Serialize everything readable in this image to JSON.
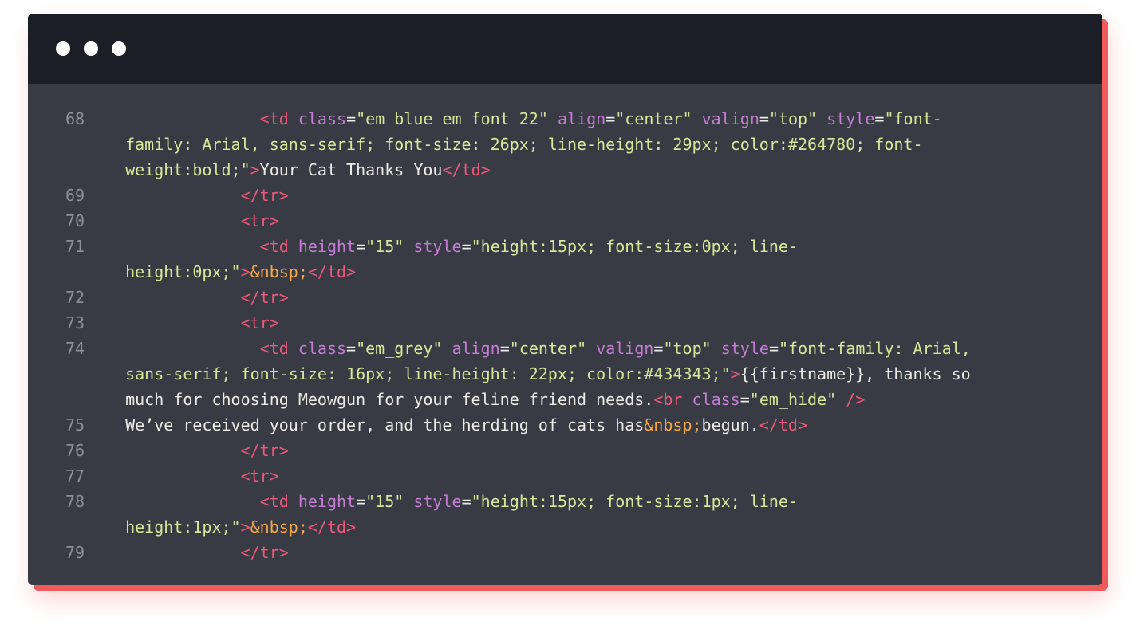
{
  "window": {
    "controls": [
      "window-dot-1",
      "window-dot-2",
      "window-dot-3"
    ]
  },
  "code": {
    "lines": [
      {
        "num": "68",
        "rows": [
          [
            {
              "t": "                <",
              "c": "tag"
            },
            {
              "t": "td",
              "c": "tag"
            },
            {
              "t": " ",
              "c": "plain"
            },
            {
              "t": "class",
              "c": "attr"
            },
            {
              "t": "=",
              "c": "plain"
            },
            {
              "t": "\"em_blue em_font_22\"",
              "c": "str"
            },
            {
              "t": " ",
              "c": "plain"
            },
            {
              "t": "align",
              "c": "attr"
            },
            {
              "t": "=",
              "c": "plain"
            },
            {
              "t": "\"center\"",
              "c": "str"
            },
            {
              "t": " ",
              "c": "plain"
            },
            {
              "t": "valign",
              "c": "attr"
            },
            {
              "t": "=",
              "c": "plain"
            },
            {
              "t": "\"top\"",
              "c": "str"
            },
            {
              "t": " ",
              "c": "plain"
            },
            {
              "t": "style",
              "c": "attr"
            },
            {
              "t": "=",
              "c": "plain"
            },
            {
              "t": "\"font-",
              "c": "str"
            }
          ],
          [
            {
              "t": "  family: Arial, sans-serif; font-size: 26px; line-height: 29px; color:#264780; font-",
              "c": "str"
            }
          ],
          [
            {
              "t": "  weight:bold;\"",
              "c": "str"
            },
            {
              "t": ">",
              "c": "tag"
            },
            {
              "t": "Your Cat Thanks You",
              "c": "plain"
            },
            {
              "t": "</td>",
              "c": "tag"
            }
          ]
        ]
      },
      {
        "num": "69",
        "rows": [
          [
            {
              "t": "              </tr>",
              "c": "tag"
            }
          ]
        ]
      },
      {
        "num": "70",
        "rows": [
          [
            {
              "t": "              <tr>",
              "c": "tag"
            }
          ]
        ]
      },
      {
        "num": "71",
        "rows": [
          [
            {
              "t": "                <td ",
              "c": "tag"
            },
            {
              "t": "height",
              "c": "attr"
            },
            {
              "t": "=",
              "c": "plain"
            },
            {
              "t": "\"15\"",
              "c": "str"
            },
            {
              "t": " ",
              "c": "plain"
            },
            {
              "t": "style",
              "c": "attr"
            },
            {
              "t": "=",
              "c": "plain"
            },
            {
              "t": "\"height:15px; font-size:0px; line-",
              "c": "str"
            }
          ],
          [
            {
              "t": "  height:0px;\"",
              "c": "str"
            },
            {
              "t": ">",
              "c": "tag"
            },
            {
              "t": "&nbsp;",
              "c": "ent"
            },
            {
              "t": "</td>",
              "c": "tag"
            }
          ]
        ]
      },
      {
        "num": "72",
        "rows": [
          [
            {
              "t": "              </tr>",
              "c": "tag"
            }
          ]
        ]
      },
      {
        "num": "73",
        "rows": [
          [
            {
              "t": "              <tr>",
              "c": "tag"
            }
          ]
        ]
      },
      {
        "num": "74",
        "rows": [
          [
            {
              "t": "                <td ",
              "c": "tag"
            },
            {
              "t": "class",
              "c": "attr"
            },
            {
              "t": "=",
              "c": "plain"
            },
            {
              "t": "\"em_grey\"",
              "c": "str"
            },
            {
              "t": " ",
              "c": "plain"
            },
            {
              "t": "align",
              "c": "attr"
            },
            {
              "t": "=",
              "c": "plain"
            },
            {
              "t": "\"center\"",
              "c": "str"
            },
            {
              "t": " ",
              "c": "plain"
            },
            {
              "t": "valign",
              "c": "attr"
            },
            {
              "t": "=",
              "c": "plain"
            },
            {
              "t": "\"top\"",
              "c": "str"
            },
            {
              "t": " ",
              "c": "plain"
            },
            {
              "t": "style",
              "c": "attr"
            },
            {
              "t": "=",
              "c": "plain"
            },
            {
              "t": "\"font-family: Arial,",
              "c": "str"
            }
          ],
          [
            {
              "t": "  sans-serif; font-size: 16px; line-height: 22px; color:#434343;\"",
              "c": "str"
            },
            {
              "t": ">",
              "c": "tag"
            },
            {
              "t": "{{firstname}}, thanks so",
              "c": "plain"
            }
          ],
          [
            {
              "t": "  much for choosing Meowgun for your feline friend needs.",
              "c": "plain"
            },
            {
              "t": "<br ",
              "c": "tag"
            },
            {
              "t": "class",
              "c": "attr"
            },
            {
              "t": "=",
              "c": "plain"
            },
            {
              "t": "\"em_hide\"",
              "c": "str"
            },
            {
              "t": " />",
              "c": "tag"
            }
          ]
        ]
      },
      {
        "num": "75",
        "rows": [
          [
            {
              "t": "  We’ve received your order, and the herding of cats has",
              "c": "plain"
            },
            {
              "t": "&nbsp;",
              "c": "ent"
            },
            {
              "t": "begun.",
              "c": "plain"
            },
            {
              "t": "</td>",
              "c": "tag"
            }
          ]
        ]
      },
      {
        "num": "76",
        "rows": [
          [
            {
              "t": "              </tr>",
              "c": "tag"
            }
          ]
        ]
      },
      {
        "num": "77",
        "rows": [
          [
            {
              "t": "              <tr>",
              "c": "tag"
            }
          ]
        ]
      },
      {
        "num": "78",
        "rows": [
          [
            {
              "t": "                <td ",
              "c": "tag"
            },
            {
              "t": "height",
              "c": "attr"
            },
            {
              "t": "=",
              "c": "plain"
            },
            {
              "t": "\"15\"",
              "c": "str"
            },
            {
              "t": " ",
              "c": "plain"
            },
            {
              "t": "style",
              "c": "attr"
            },
            {
              "t": "=",
              "c": "plain"
            },
            {
              "t": "\"height:15px; font-size:1px; line-",
              "c": "str"
            }
          ],
          [
            {
              "t": "  height:1px;\"",
              "c": "str"
            },
            {
              "t": ">",
              "c": "tag"
            },
            {
              "t": "&nbsp;",
              "c": "ent"
            },
            {
              "t": "</td>",
              "c": "tag"
            }
          ]
        ]
      },
      {
        "num": "79",
        "rows": [
          [
            {
              "t": "              </tr>",
              "c": "tag"
            }
          ]
        ]
      }
    ]
  },
  "colors": {
    "frame": "#ef5a5a",
    "editor_bg": "#383b43",
    "titlebar_bg": "#1b1e24",
    "line_number": "#8d9098",
    "tag": "#f0587a",
    "attribute": "#c77dd8",
    "string": "#d6e79a",
    "text": "#ecebe6",
    "entity": "#f6a94a"
  }
}
